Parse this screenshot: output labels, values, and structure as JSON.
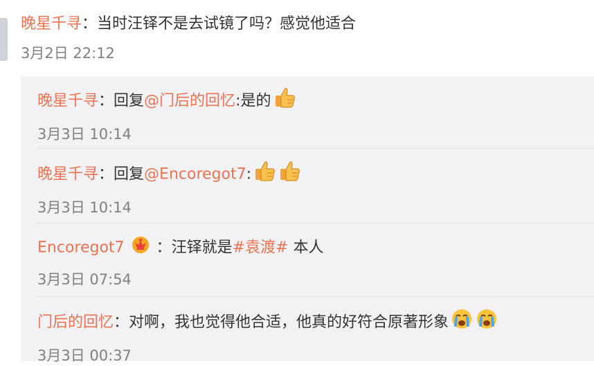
{
  "main_comment": {
    "user": "晚星千寻",
    "sep": "：",
    "text": "当时汪铎不是去试镜了吗？感觉他适合",
    "time": "3月2日 22:12"
  },
  "replies": [
    {
      "user": "晚星千寻",
      "sep": "：",
      "prefix": "回复",
      "mention": "@门后的回忆",
      "colon": ":",
      "text": "是的",
      "emoji": "thumbs-up-icon",
      "time": "3月3日 10:14"
    },
    {
      "user": "晚星千寻",
      "sep": "：",
      "prefix": "回复",
      "mention": "@Encoregot7",
      "colon": ":",
      "text": "",
      "emoji": "thumbs-up-icon",
      "time": "3月3日 10:14"
    },
    {
      "user": "Encoregot7",
      "badge": "crown-badge-icon",
      "sep": "：",
      "text": "汪铎就是",
      "topic": "#袁渡#",
      "text2": " 本人",
      "time": "3月3日 07:54"
    },
    {
      "user": "门后的回忆",
      "sep": "：",
      "text": "对啊，我也觉得他合适，他真的好符合原著形象",
      "emoji": "crying-face-icon",
      "time": "3月3日 00:37"
    }
  ],
  "colors": {
    "username": "#eb7350",
    "text": "#333333",
    "time": "#808080",
    "reply_bg": "#f2f2f5"
  }
}
